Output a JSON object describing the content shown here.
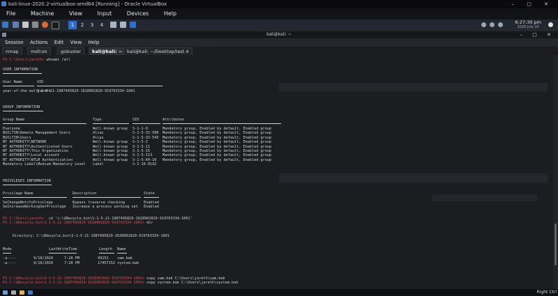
{
  "window": {
    "title": "kali-linux-2020.2-virtualbox-amd64 [Running] - Oracle VirtualBox"
  },
  "vbox_menu": [
    "File",
    "Machine",
    "View",
    "Input",
    "Devices",
    "Help"
  ],
  "xfce_panel": {
    "workspaces": [
      "1",
      "2",
      "3",
      "4"
    ],
    "clock_time": "6:27:30 pm",
    "clock_date": "2026 July 10"
  },
  "terminal": {
    "title": "kali@kali: ~",
    "menu": [
      "Session",
      "Actions",
      "Edit",
      "View",
      "Help"
    ],
    "tabs": [
      "nmap",
      "msfcon",
      "gobuster",
      "kali@kali: ~",
      "kali@kali: ~/Desktop/test.4"
    ]
  },
  "console": {
    "prompt_prefix": "PS",
    "prompt_user": "PS C:\\Users\\jareth>",
    "cmd1": "whoami /all",
    "user_info_header": "USER INFORMATION",
    "user_cols": [
      "User Name",
      "SID"
    ],
    "user_row": [
      "year-of-the-owl\\jareth",
      "S-1-5-21-1987495829-1628902820-919763334-1001"
    ],
    "group_info_header": "GROUP INFORMATION",
    "group_cols": [
      "Group Name",
      "Type",
      "SID",
      "Attributes"
    ],
    "groups": [
      [
        "Everyone",
        "Well-known group",
        "S-1-1-0",
        "Mandatory group, Enabled by default, Enabled group"
      ],
      [
        "BUILTIN\\Remote Management Users",
        "Alias",
        "S-1-5-32-580",
        "Mandatory group, Enabled by default, Enabled group"
      ],
      [
        "BUILTIN\\Users",
        "Alias",
        "S-1-5-32-545",
        "Mandatory group, Enabled by default, Enabled group"
      ],
      [
        "NT AUTHORITY\\NETWORK",
        "Well-known group",
        "S-1-5-2",
        "Mandatory group, Enabled by default, Enabled group"
      ],
      [
        "NT AUTHORITY\\Authenticated Users",
        "Well-known group",
        "S-1-5-11",
        "Mandatory group, Enabled by default, Enabled group"
      ],
      [
        "NT AUTHORITY\\This Organization",
        "Well-known group",
        "S-1-5-15",
        "Mandatory group, Enabled by default, Enabled group"
      ],
      [
        "NT AUTHORITY\\Local account",
        "Well-known group",
        "S-1-5-113",
        "Mandatory group, Enabled by default, Enabled group"
      ],
      [
        "NT AUTHORITY\\NTLM Authentication",
        "Well-known group",
        "S-1-5-64-10",
        "Mandatory group, Enabled by default, Enabled group"
      ],
      [
        "Mandatory Label\\Medium Mandatory Level",
        "Label",
        "S-1-16-8192",
        ""
      ]
    ],
    "priv_header": "PRIVILEGES INFORMATION",
    "priv_cols": [
      "Privilege Name",
      "Description",
      "State"
    ],
    "privs": [
      [
        "SeChangeNotifyPrivilege",
        "Bypass traverse checking",
        "Enabled"
      ],
      [
        "SeIncreaseWorkingSetPrivilege",
        "Increase a process working set",
        "Enabled"
      ]
    ],
    "cmd2": "cd 'c:\\$Recycle.bin\\S-1-5-21-1987495829-1628902820-919763334-1001'",
    "prompt_recycle": "PS C:\\$Recycle.bin\\S-1-5-21-1987495829-1628902820-919763334-1001>",
    "cmd3": "dir",
    "directory_line": "Directory: C:\\$Recycle.bin\\S-1-5-21-1987495829-1628902820-919763334-1001",
    "dir_cols": [
      "Mode",
      "LastWriteTime",
      "Length",
      "Name"
    ],
    "dir_rows": [
      [
        "-a----",
        "9/18/2020",
        "7:28 PM",
        "49152",
        "sam.bak"
      ],
      [
        "-a----",
        "9/18/2020",
        "7:28 PM",
        "17457152",
        "system.bak"
      ]
    ],
    "cmd4": "copy sam.bak C:\\Users\\jareth\\sam.bak",
    "cmd5": "copy system.bak C:\\Users\\jareth\\system.bak"
  },
  "taskbar": {
    "right_label": "Right Ctrl"
  }
}
